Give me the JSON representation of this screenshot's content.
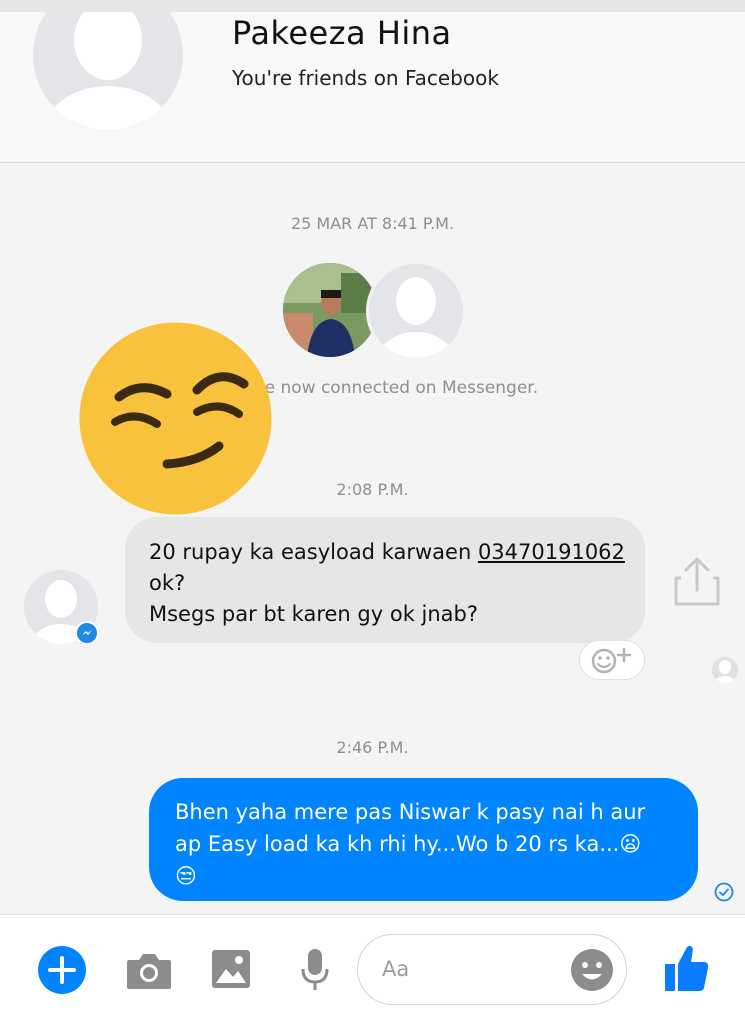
{
  "header": {
    "contact_name": "Pakeeza Hina",
    "friend_status": "You're friends on Facebook"
  },
  "conversation": {
    "timestamp_1": "25 MAR AT 8:41 P.M.",
    "connected_text": "re now connected on Messenger.",
    "timestamp_2": "2:08 P.M.",
    "incoming_message": {
      "line1_prefix": "20 rupay ka easyload karwaen ",
      "phone": "03470191062",
      "line2": "ok?",
      "line3": "Msegs par bt karen gy ok jnab?"
    },
    "timestamp_3": "2:46 P.M.",
    "outgoing_message": {
      "line1": "Bhen yaha mere pas Niswar k pasy nai h aur",
      "line2": "ap Easy load ka kh rhi hy...Wo b 20 rs ka...😦",
      "line3": "😒"
    }
  },
  "composer": {
    "placeholder": "Aa"
  },
  "icons": {
    "add": "plus-icon",
    "camera": "camera-icon",
    "gallery": "image-icon",
    "voice": "microphone-icon",
    "emoji": "smiley-icon",
    "like": "thumbs-up-icon",
    "share": "share-icon",
    "reaction": "add-reaction-icon",
    "sticker": "smirk-emoji-sticker"
  },
  "colors": {
    "accent": "#0084ff",
    "incoming_bubble": "#e6e6e6",
    "like_icon": "#0a7cff"
  }
}
